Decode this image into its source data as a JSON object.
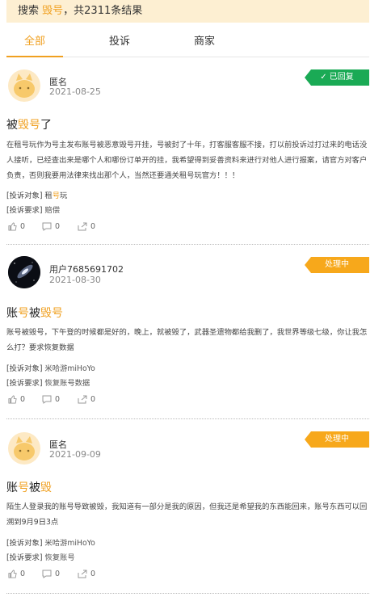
{
  "search": {
    "prefix": "搜索 ",
    "keyword": "毁号",
    "suffix": "，共2311条结果"
  },
  "tabs": [
    {
      "label": "全部",
      "active": true
    },
    {
      "label": "投诉",
      "active": false
    },
    {
      "label": "商家",
      "active": false
    }
  ],
  "labels": {
    "target": "[投诉对象]",
    "demand": "[投诉要求]"
  },
  "posts": [
    {
      "user": "匿名",
      "date": "2021-08-25",
      "avatar": "cat-icon",
      "status": "已回复",
      "status_color": "#1aaa55",
      "title_parts": [
        "被",
        "毁号",
        "了"
      ],
      "content": "在租号玩作为号主发布账号被恶意毁号开挂，号被封了十年，打客服客服不接，打以前投诉过打过来的电话没人接听，已经查出来是哪个人和哪份订单开的挂，我希望得到妥善资料来进行对他人进行报案，请官方对客户负责，否则我要用法律来找出那个人，当然还要通关租号玩官方！！！",
      "target_parts": [
        "租",
        "号",
        "玩"
      ],
      "demand": "赔偿",
      "likes": "0",
      "comments": "0",
      "shares": "0"
    },
    {
      "user": "用户7685691702",
      "date": "2021-08-30",
      "avatar": "galaxy-icon",
      "status": "处理中",
      "status_color": "#f7a81b",
      "title_parts": [
        "账",
        "号",
        "被",
        "毁号"
      ],
      "content": "账号被毁号，下午登的时候都是好的，晚上，就被毁了，武器圣遗物都给我删了，我世界等级七级，你让我怎么打？要求恢复数据",
      "target": "米哈游miHoYo",
      "demand": "恢复账号数据",
      "likes": "0",
      "comments": "0",
      "shares": "0"
    },
    {
      "user": "匿名",
      "date": "2021-09-09",
      "avatar": "cat-icon",
      "status": "处理中",
      "status_color": "#f7a81b",
      "title_parts": [
        "账",
        "号",
        "被",
        "毁"
      ],
      "content": "陌生人登录我的账号导致被毁，我知道有一部分是我的原因，但我还是希望我的东西能回来，账号东西可以回溯到9月9日3点",
      "target": "米哈游miHoYo",
      "demand": "恢复账号",
      "likes": "0",
      "comments": "0",
      "shares": "0"
    }
  ]
}
